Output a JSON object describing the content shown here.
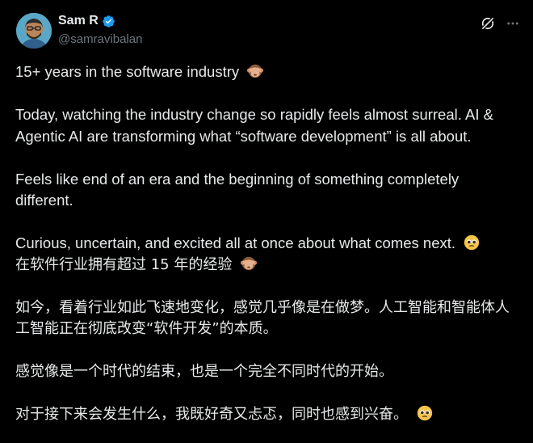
{
  "author": {
    "display_name": "Sam R",
    "handle": "@samravibalan",
    "verified_icon": "verified-badge-icon",
    "avatar_icon": "avatar-illustration"
  },
  "actions": {
    "grok_icon": "grok-icon",
    "more_icon": "more-options-icon"
  },
  "post": {
    "en": {
      "line1": "15+ years in the software industry",
      "para2": "Today, watching the industry change so rapidly feels almost surreal. AI & Agentic AI are transforming what “software development” is all about.",
      "para3": "Feels like end of an era and the beginning of something completely different.",
      "para4": "Curious, uncertain, and excited all at once about what comes next."
    },
    "zh": {
      "line1": "在软件行业拥有超过 15 年的经验",
      "para2": "如今，看着行业如此飞速地变化，感觉几乎像是在做梦。人工智能和智能体人工智能正在彻底改变“软件开发”的本质。",
      "para3": "感觉像是一个时代的结束，也是一个完全不同时代的开始。",
      "para4": "对于接下来会发生什么，我既好奇又忐忑，同时也感到兴奋。"
    },
    "emojis": {
      "see_no_evil": "see-no-evil-monkey-emoji",
      "pleading": "pleading-face-emoji"
    }
  },
  "colors": {
    "background": "#000000",
    "text": "#e7e9ea",
    "secondary_text": "#71767b",
    "verified": "#1d9bf0"
  }
}
